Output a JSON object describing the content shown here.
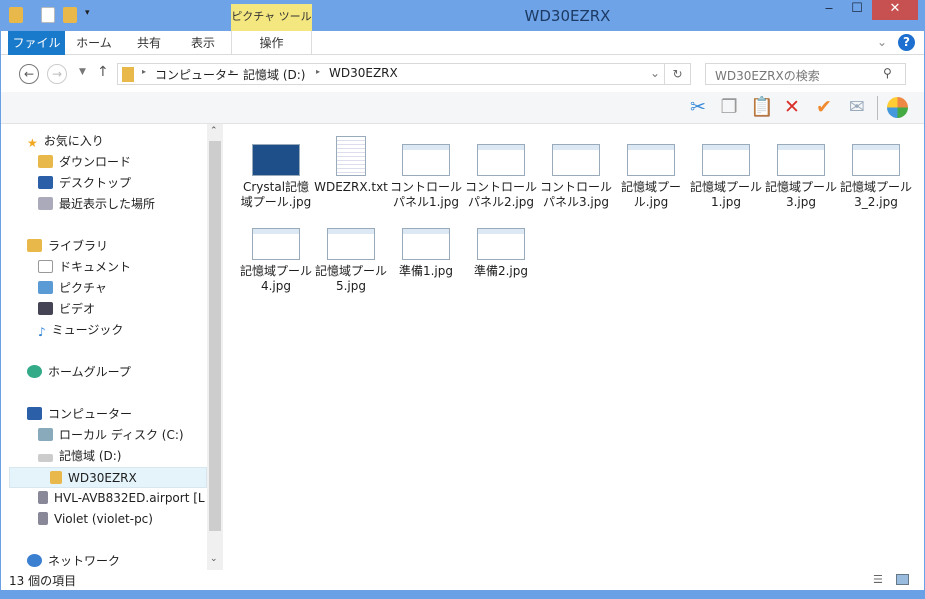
{
  "window": {
    "title": "WD30EZRX",
    "context_tab": "ピクチャ ツール",
    "minimize": "‒",
    "maximize": "☐",
    "close": "✕"
  },
  "ribbon": {
    "tabs": [
      "ファイル",
      "ホーム",
      "共有",
      "表示",
      "操作"
    ]
  },
  "address": {
    "path": [
      "コンピューター",
      "記憶域 (D:)",
      "WD30EZRX"
    ],
    "search_placeholder": "WD30EZRXの検索"
  },
  "nav": {
    "favorites": {
      "label": "お気に入り",
      "items": [
        "ダウンロード",
        "デスクトップ",
        "最近表示した場所"
      ]
    },
    "libraries": {
      "label": "ライブラリ",
      "items": [
        "ドキュメント",
        "ピクチャ",
        "ビデオ",
        "ミュージック"
      ]
    },
    "homegroup": "ホームグループ",
    "computer": {
      "label": "コンピューター",
      "items": [
        "ローカル ディスク (C:)",
        "記憶域 (D:)",
        "WD30EZRX",
        "HVL-AVB832ED.airport [L",
        "Violet (violet-pc)"
      ]
    },
    "network": "ネットワーク"
  },
  "files": [
    "Crystal記憶域プール.jpg",
    "WDEZRX.txt",
    "コントロールパネル1.jpg",
    "コントロールパネル2.jpg",
    "コントロールパネル3.jpg",
    "記憶域プール.jpg",
    "記憶域プール1.jpg",
    "記憶域プール3.jpg",
    "記憶域プール3_2.jpg",
    "記憶域プール4.jpg",
    "記憶域プール5.jpg",
    "準備1.jpg",
    "準備2.jpg"
  ],
  "status": {
    "count": "13 個の項目"
  }
}
